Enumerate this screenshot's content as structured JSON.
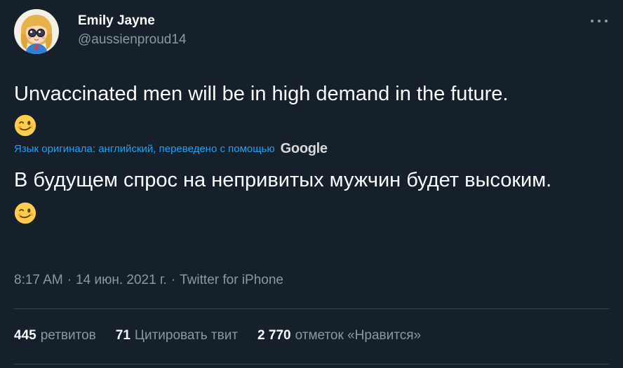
{
  "author": {
    "display_name": "Emily Jayne",
    "handle": "@aussienproud14"
  },
  "tweet": {
    "original_text": "Unvaccinated men will be in high demand in the future.",
    "original_emoji": "winking-face",
    "translation_notice": "Язык оригинала: английский, переведено с помощью",
    "translation_provider": "Google",
    "translated_text": "В будущем спрос на непривитых мужчин будет высоким.",
    "translated_emoji": "winking-face"
  },
  "meta": {
    "time": "8:17 AM",
    "separator": "·",
    "date": "14 июн. 2021 г.",
    "source": "Twitter for iPhone"
  },
  "stats": {
    "retweets_count": "445",
    "retweets_label": "ретвитов",
    "quotes_count": "71",
    "quotes_label": "Цитировать твит",
    "likes_count": "2 770",
    "likes_label": "отметок «Нравится»"
  },
  "colors": {
    "background": "#15202b",
    "text_primary": "#ffffff",
    "text_secondary": "#8899a6",
    "link": "#1da1f2",
    "divider": "#38444d"
  }
}
